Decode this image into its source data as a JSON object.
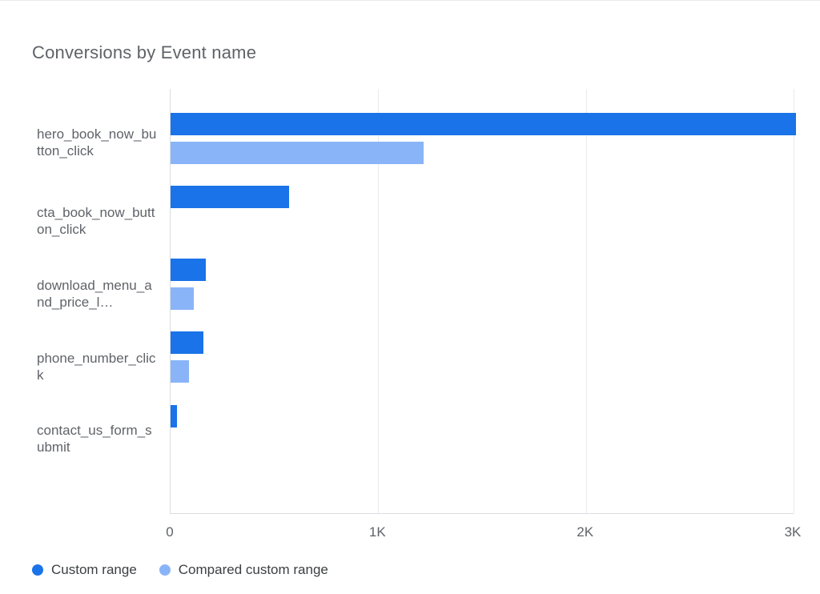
{
  "title": "Conversions by Event name",
  "legend": {
    "series_a": "Custom range",
    "series_b": "Compared custom range"
  },
  "x_ticks": [
    "0",
    "1K",
    "2K",
    "3K"
  ],
  "y_labels_display": [
    "hero_book_now_button_click",
    "cta_book_now_button_click",
    "download_menu_and_price_l…",
    "phone_number_click",
    "contact_us_form_submit"
  ],
  "chart_data": {
    "type": "bar",
    "orientation": "horizontal",
    "title": "Conversions by Event name",
    "xlabel": "",
    "ylabel": "",
    "xlim": [
      0,
      3000
    ],
    "x_ticks": [
      0,
      1000,
      2000,
      3000
    ],
    "categories": [
      "hero_book_now_button_click",
      "cta_book_now_button_click",
      "download_menu_and_price_l…",
      "phone_number_click",
      "contact_us_form_submit"
    ],
    "series": [
      {
        "name": "Custom range",
        "color": "#1a73e8",
        "values": [
          3010,
          570,
          170,
          160,
          30
        ]
      },
      {
        "name": "Compared custom range",
        "color": "#8ab4f8",
        "values": [
          1220,
          0,
          110,
          90,
          0
        ]
      }
    ],
    "legend_position": "bottom-left",
    "grid": {
      "x": true,
      "y": false
    }
  }
}
